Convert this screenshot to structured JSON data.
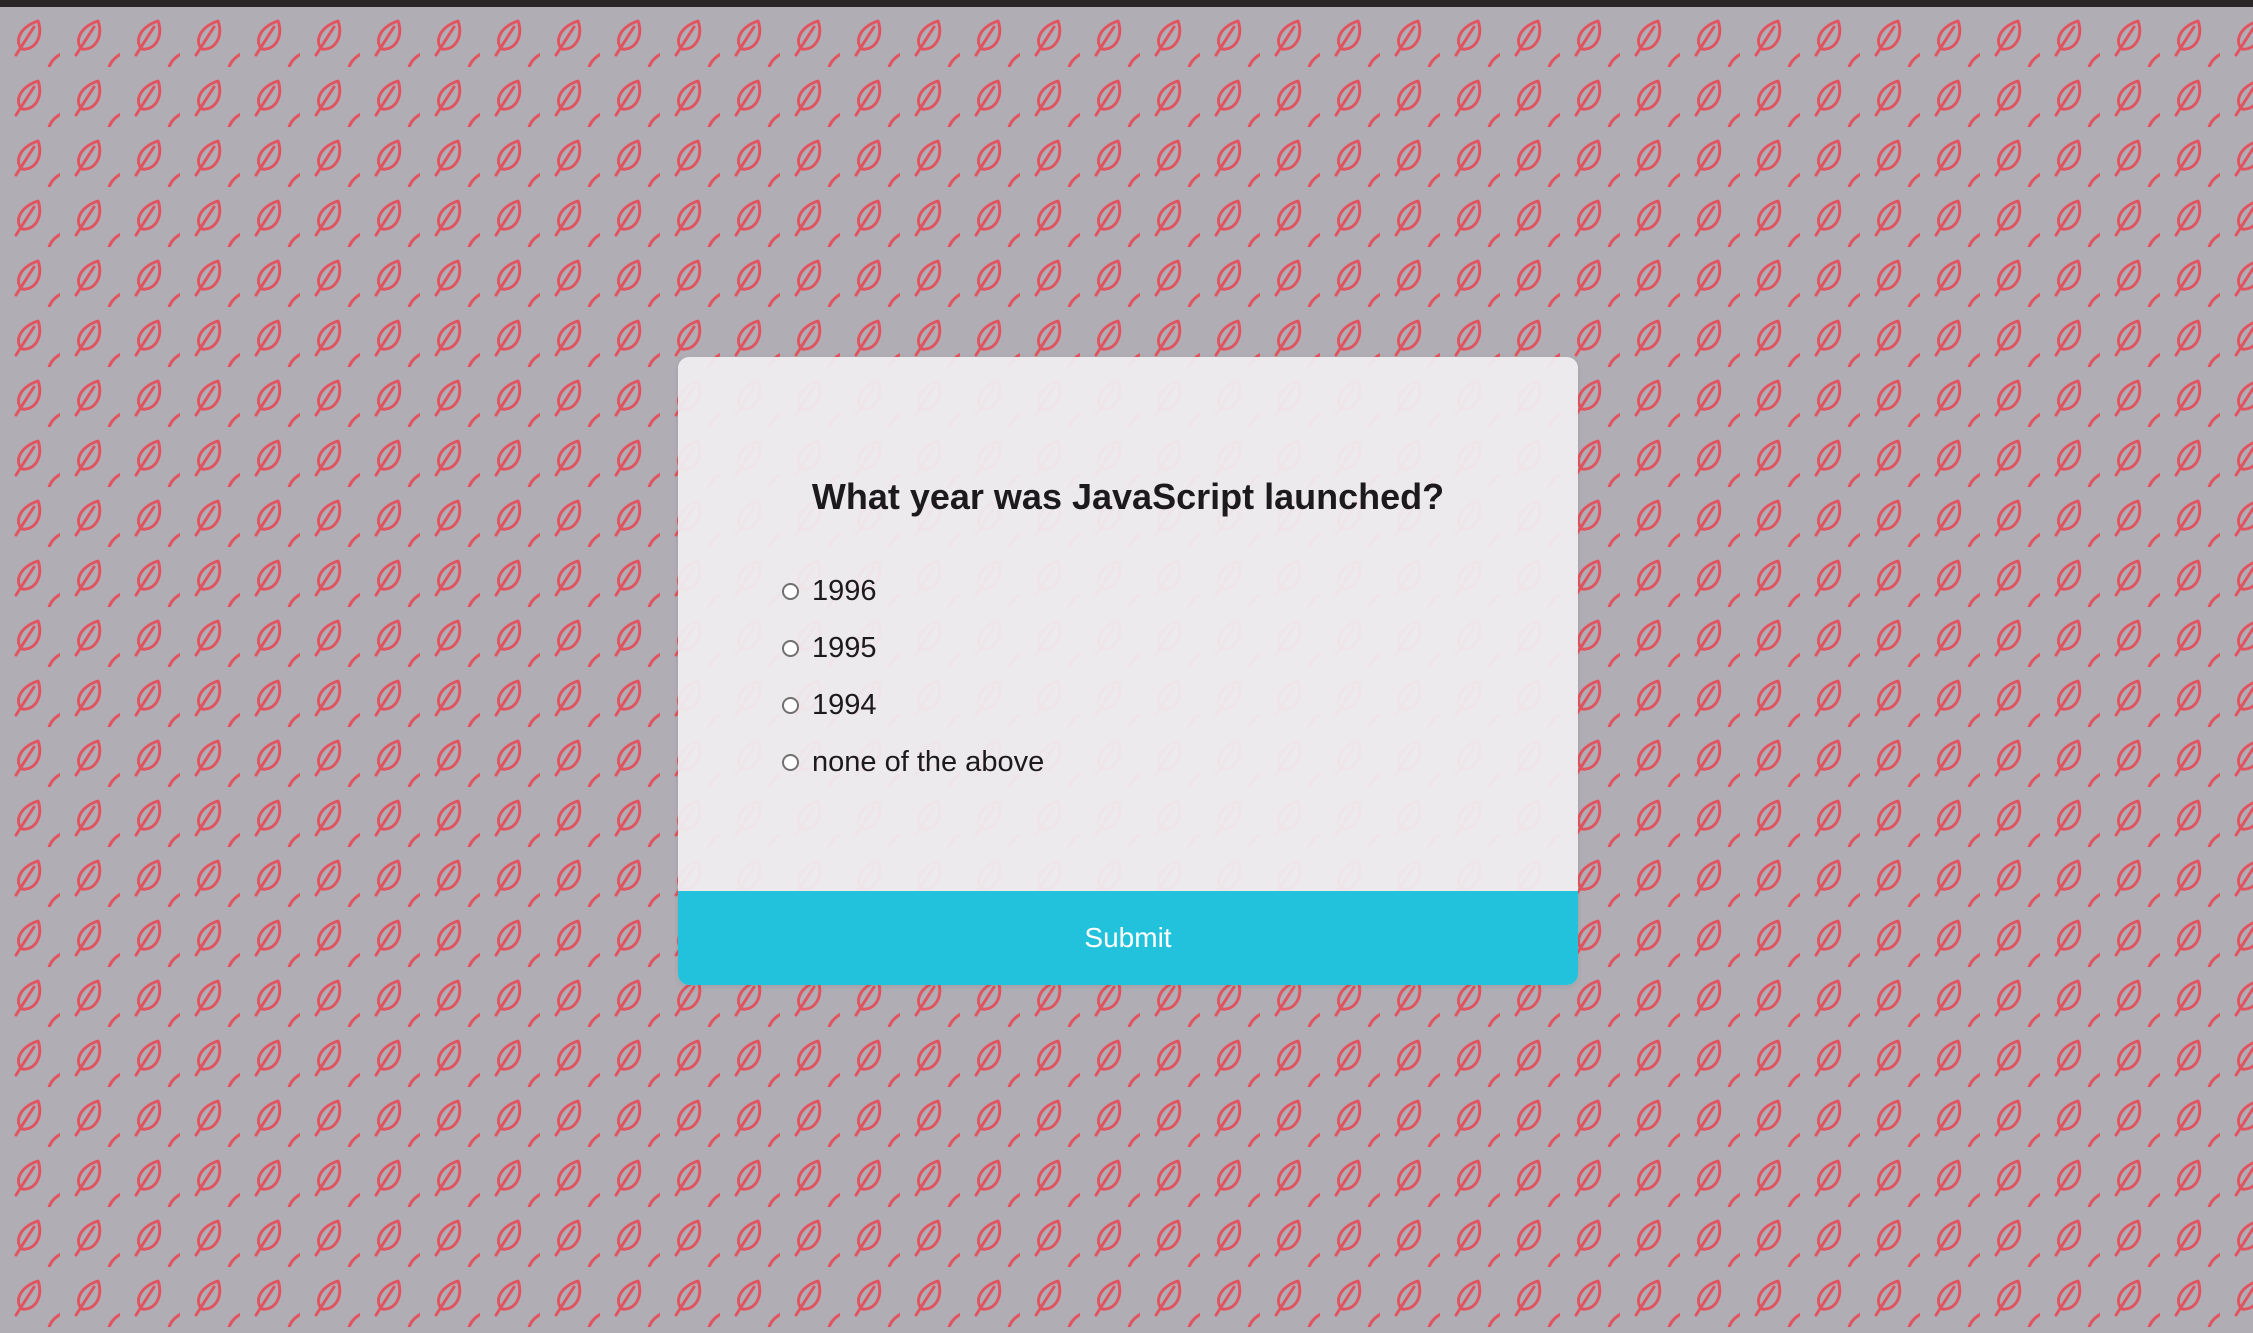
{
  "colors": {
    "background": "#b1adb5",
    "pattern_stroke": "#e0545f",
    "card_background": "#f0eff1",
    "submit_background": "#22c2dc",
    "submit_text": "#ffffff",
    "text": "#1c1a1c"
  },
  "background": {
    "pattern_icon": "leaf-icon"
  },
  "quiz": {
    "question": "What year was JavaScript launched?",
    "options": [
      {
        "label": "1996",
        "selected": false
      },
      {
        "label": "1995",
        "selected": false
      },
      {
        "label": "1994",
        "selected": false
      },
      {
        "label": "none of the above",
        "selected": false
      }
    ],
    "submit_label": "Submit"
  }
}
